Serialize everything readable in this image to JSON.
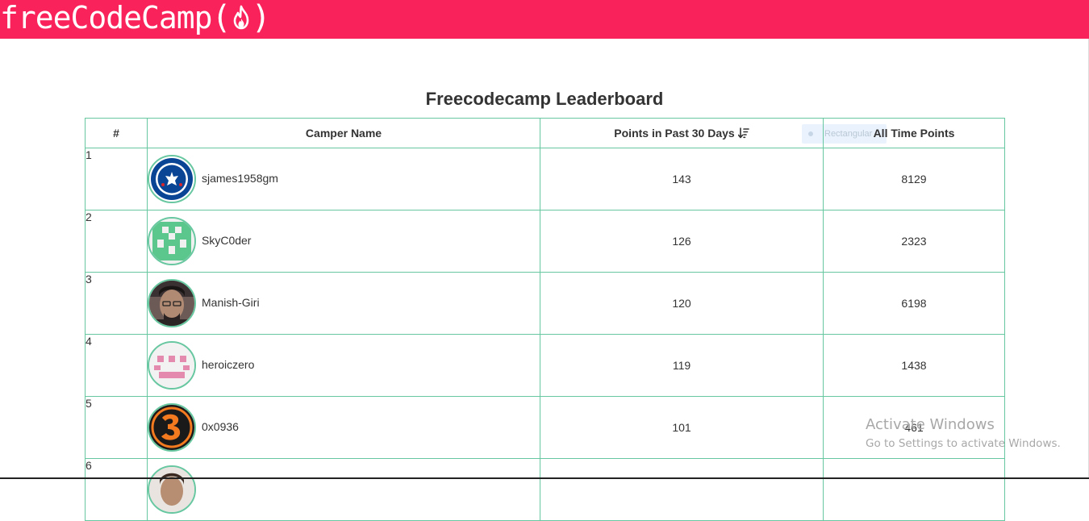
{
  "header": {
    "logo_text": "freeCodeCamp",
    "logo_open": "(",
    "logo_close": ")",
    "brand_color": "#f9225a"
  },
  "page": {
    "title": "Freecodecamp Leaderboard"
  },
  "table": {
    "columns": {
      "rank": "#",
      "camper": "Camper Name",
      "recent": "Points in Past 30 Days",
      "alltime": "All Time Points"
    },
    "sort_icon": "sort-descending-icon",
    "border_color": "#67c7a0",
    "rows": [
      {
        "rank": "1",
        "name": "sjames1958gm",
        "recent": "143",
        "alltime": "8129",
        "avatar": "chelsea-crest-avatar"
      },
      {
        "rank": "2",
        "name": "SkyC0der",
        "recent": "126",
        "alltime": "2323",
        "avatar": "green-identicon-avatar"
      },
      {
        "rank": "3",
        "name": "Manish-Giri",
        "recent": "120",
        "alltime": "6198",
        "avatar": "photo-avatar"
      },
      {
        "rank": "4",
        "name": "heroiczero",
        "recent": "119",
        "alltime": "1438",
        "avatar": "pink-identicon-avatar"
      },
      {
        "rank": "5",
        "name": "0x0936",
        "recent": "101",
        "alltime": "461",
        "avatar": "number-three-avatar"
      },
      {
        "rank": "6"
      }
    ]
  },
  "overlay": {
    "ghost_label": "Rectangular"
  },
  "watermark": {
    "line1": "Activate Windows",
    "line2": "Go to Settings to activate Windows."
  }
}
